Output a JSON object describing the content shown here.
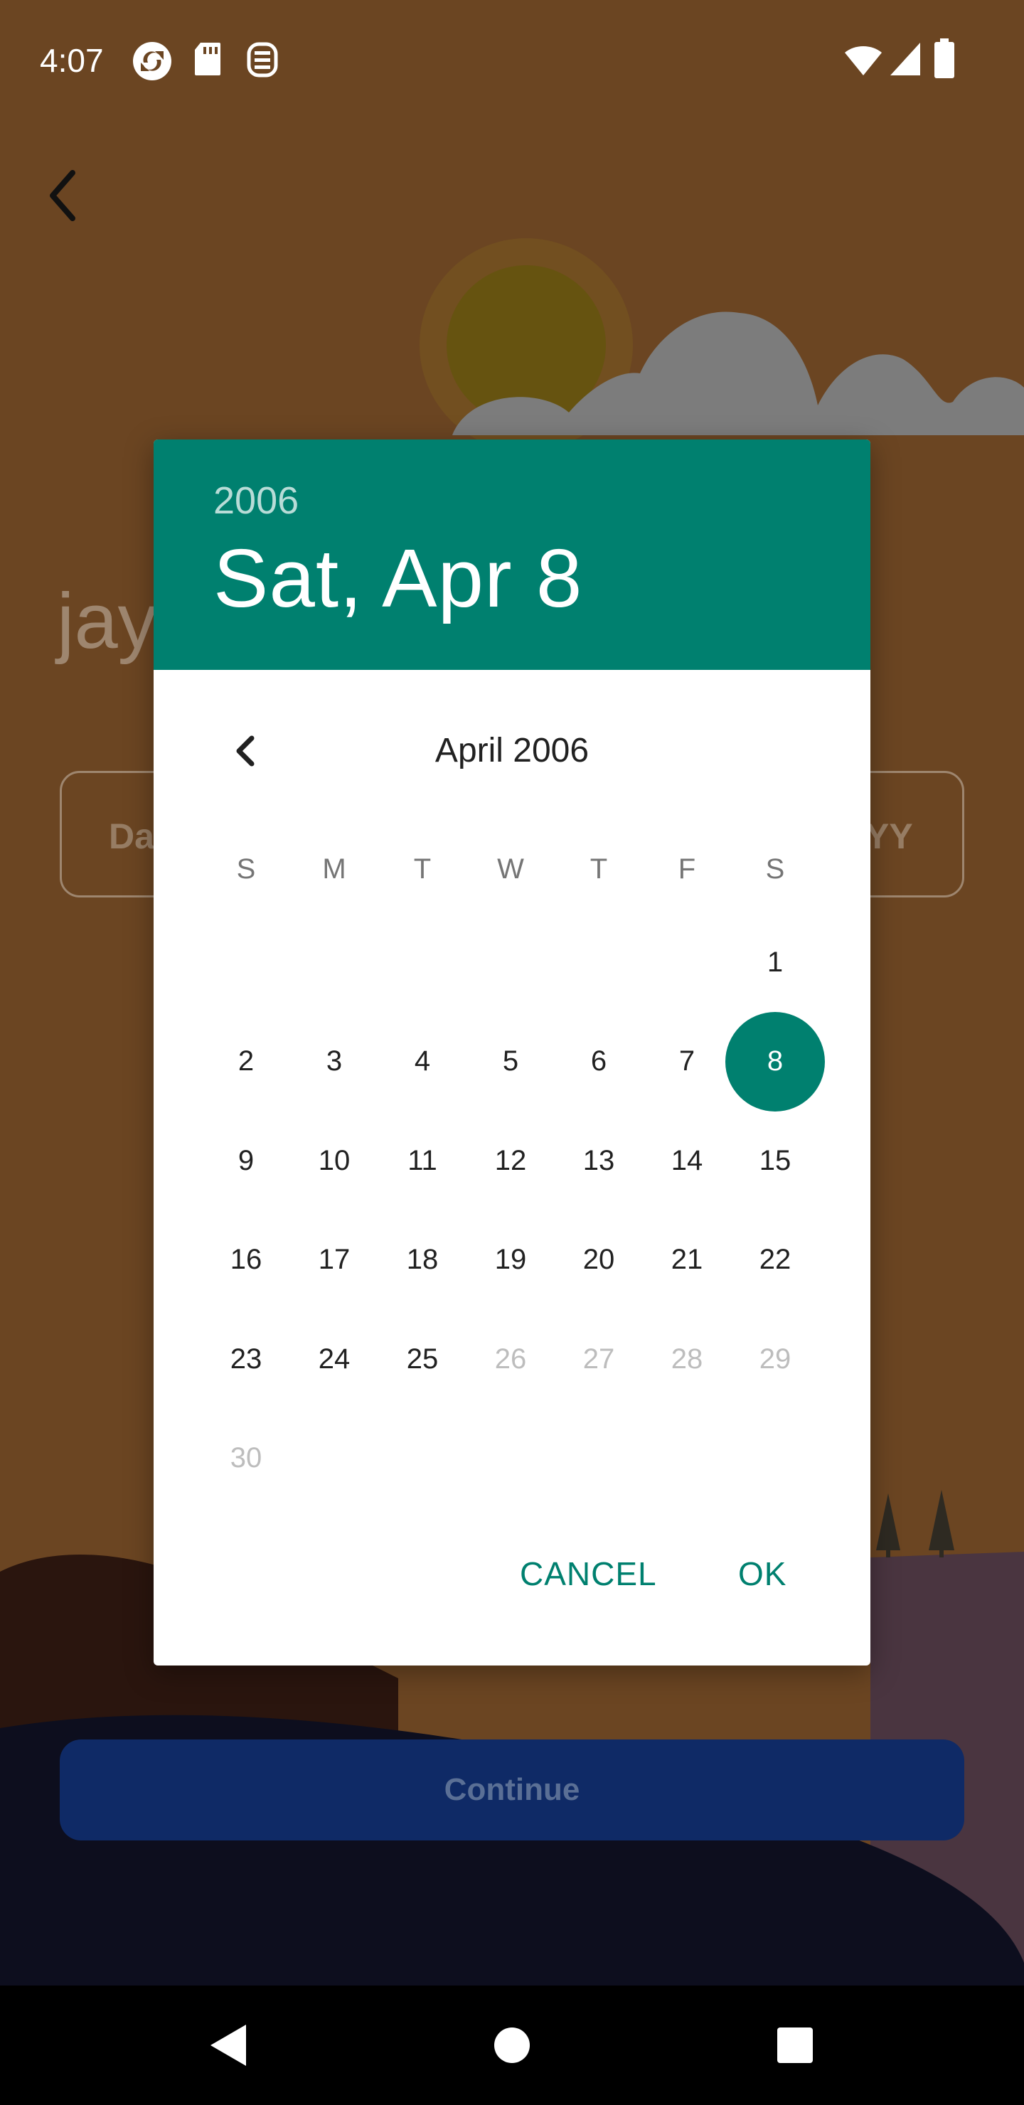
{
  "status_bar": {
    "time": "4:07",
    "left_icons": [
      "sync-icon",
      "sd-card-icon",
      "app-notification-icon"
    ],
    "right_icons": [
      "wifi-icon",
      "cell-signal-icon",
      "battery-icon"
    ]
  },
  "background_page": {
    "name_partial": "jay",
    "day_field_partial": "Da",
    "year_field_partial": "YY",
    "continue_label": "Continue"
  },
  "date_picker": {
    "header_year": "2006",
    "header_date": "Sat, Apr 8",
    "month_title": "April 2006",
    "weekdays": [
      "S",
      "M",
      "T",
      "W",
      "T",
      "F",
      "S"
    ],
    "first_weekday_index": 6,
    "selected_day": 8,
    "enabled_through_day": 25,
    "days": [
      "1",
      "2",
      "3",
      "4",
      "5",
      "6",
      "7",
      "8",
      "9",
      "10",
      "11",
      "12",
      "13",
      "14",
      "15",
      "16",
      "17",
      "18",
      "19",
      "20",
      "21",
      "22",
      "23",
      "24",
      "25",
      "26",
      "27",
      "28",
      "29",
      "30"
    ],
    "cancel_label": "CANCEL",
    "ok_label": "OK"
  },
  "colors": {
    "accent": "#00806f",
    "scrim_background": "#6b4522",
    "continue_button": "#0f2a66"
  }
}
